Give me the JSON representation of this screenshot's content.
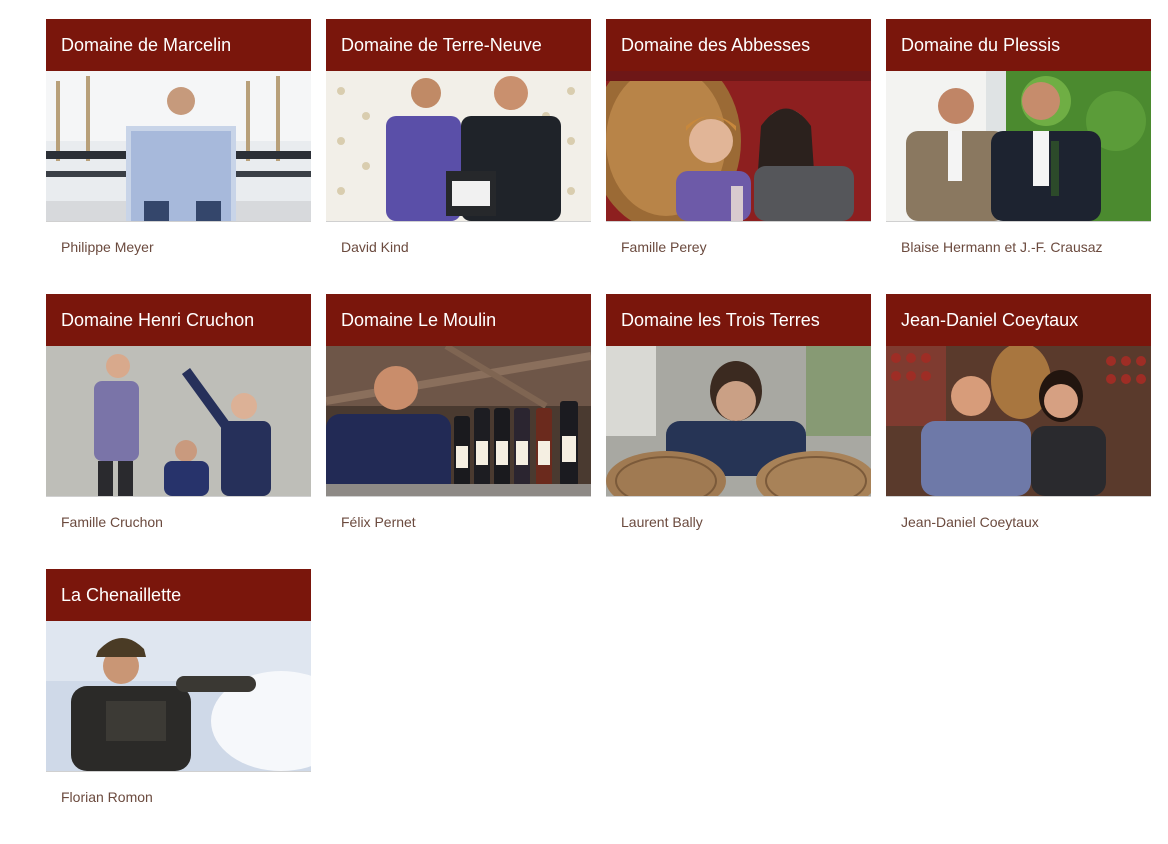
{
  "domaines": [
    {
      "title": "Domaine de Marcelin",
      "caption": "Philippe Meyer"
    },
    {
      "title": "Domaine de Terre-Neuve",
      "caption": "David Kind"
    },
    {
      "title": "Domaine des Abbesses",
      "caption": "Famille Perey"
    },
    {
      "title": "Domaine du Plessis",
      "caption": "Blaise Hermann et J.-F. Crausaz"
    },
    {
      "title": "Domaine Henri Cruchon",
      "caption": "Famille Cruchon"
    },
    {
      "title": "Domaine Le Moulin",
      "caption": "Félix Pernet"
    },
    {
      "title": "Domaine les Trois Terres",
      "caption": "Laurent Bally"
    },
    {
      "title": "Jean-Daniel Coeytaux",
      "caption": "Jean-Daniel Coeytaux"
    },
    {
      "title": "La Chenaillette",
      "caption": "Florian Romon"
    }
  ],
  "colors": {
    "title_bar": "#7a160c",
    "title_text": "#ffffff",
    "caption_text": "#6b4a3e"
  }
}
